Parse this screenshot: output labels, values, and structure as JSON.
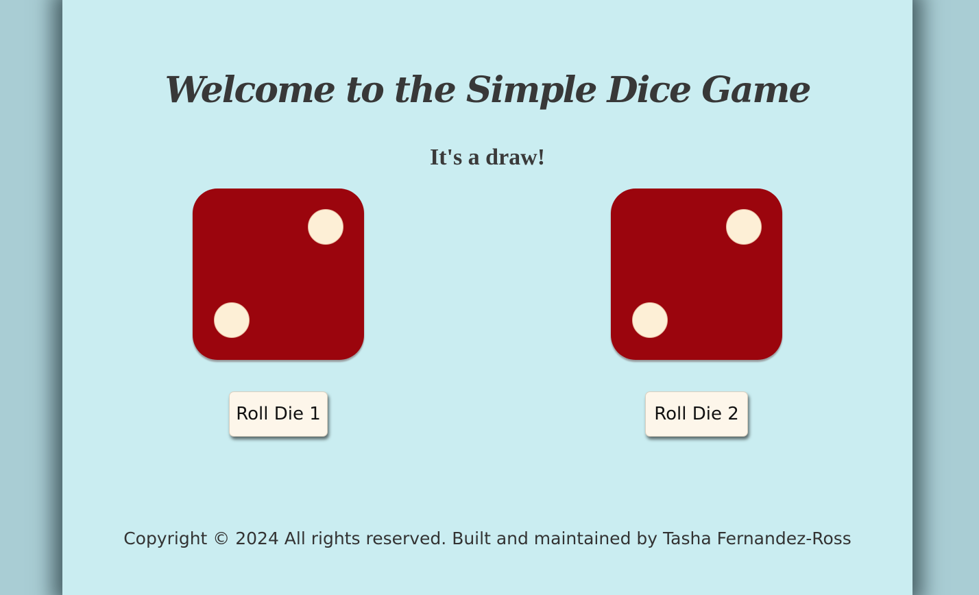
{
  "header": {
    "title": "Welcome to the Simple Dice Game"
  },
  "status": {
    "result": "It's a draw!"
  },
  "dice": [
    {
      "value": 2,
      "color": "#9b050d",
      "pip_color": "#fdefd6"
    },
    {
      "value": 2,
      "color": "#9b050d",
      "pip_color": "#fdefd6"
    }
  ],
  "buttons": {
    "roll_die_1": "Roll Die 1",
    "roll_die_2": "Roll Die 2"
  },
  "footer": {
    "text": "Copyright © 2024 All rights reserved. Built and maintained by Tasha Fernandez-Ross"
  },
  "colors": {
    "background": "#caedf1",
    "die": "#9b050d",
    "text": "#383838"
  }
}
